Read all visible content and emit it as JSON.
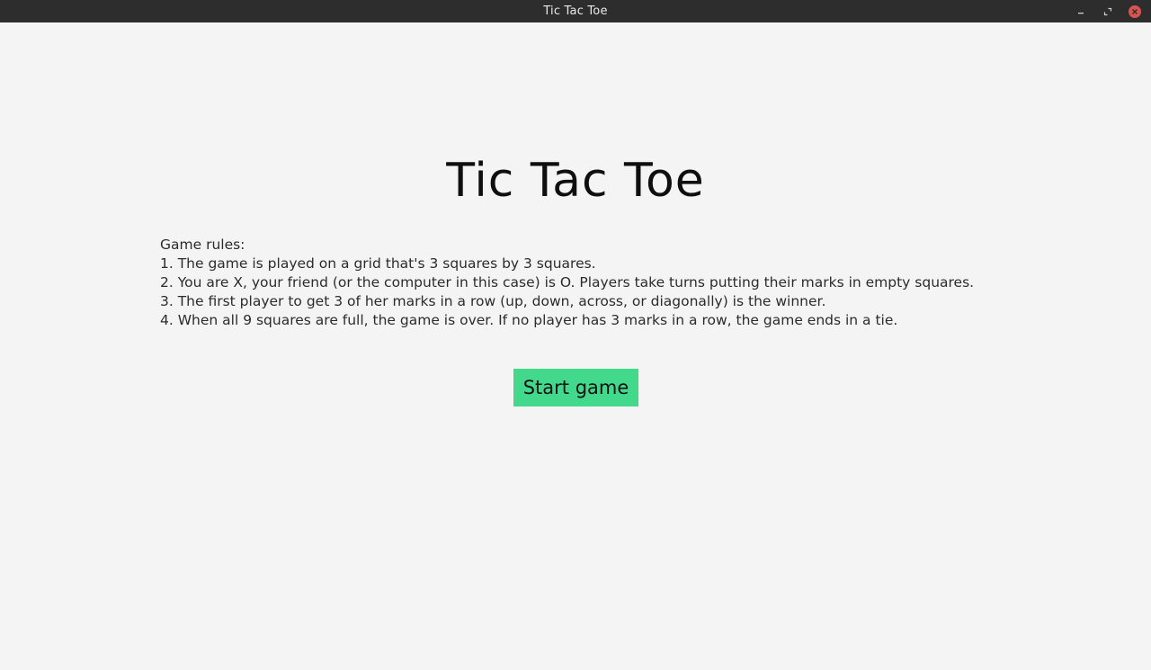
{
  "window": {
    "title": "Tic Tac Toe",
    "controls": {
      "minimize_icon": "minimize-icon",
      "maximize_icon": "maximize-icon",
      "close_icon": "close-icon"
    }
  },
  "main": {
    "heading": "Tic Tac Toe",
    "rules": {
      "header": "Game rules:",
      "items": [
        "1. The game is played on a grid that's 3 squares by 3 squares.",
        "2. You are X, your friend (or the computer in this case) is O. Players take turns putting their marks in empty squares.",
        "3. The first player to get 3 of her marks in a row (up, down, across, or diagonally) is the winner.",
        "4. When all 9 squares are full, the game is over. If no player has 3 marks in a row, the game ends in a tie."
      ]
    },
    "start_button_label": "Start game"
  },
  "colors": {
    "background": "#f4f4f4",
    "titlebar": "#2d2d2d",
    "start_button": "#42d98d",
    "close_button": "#d9534f"
  }
}
